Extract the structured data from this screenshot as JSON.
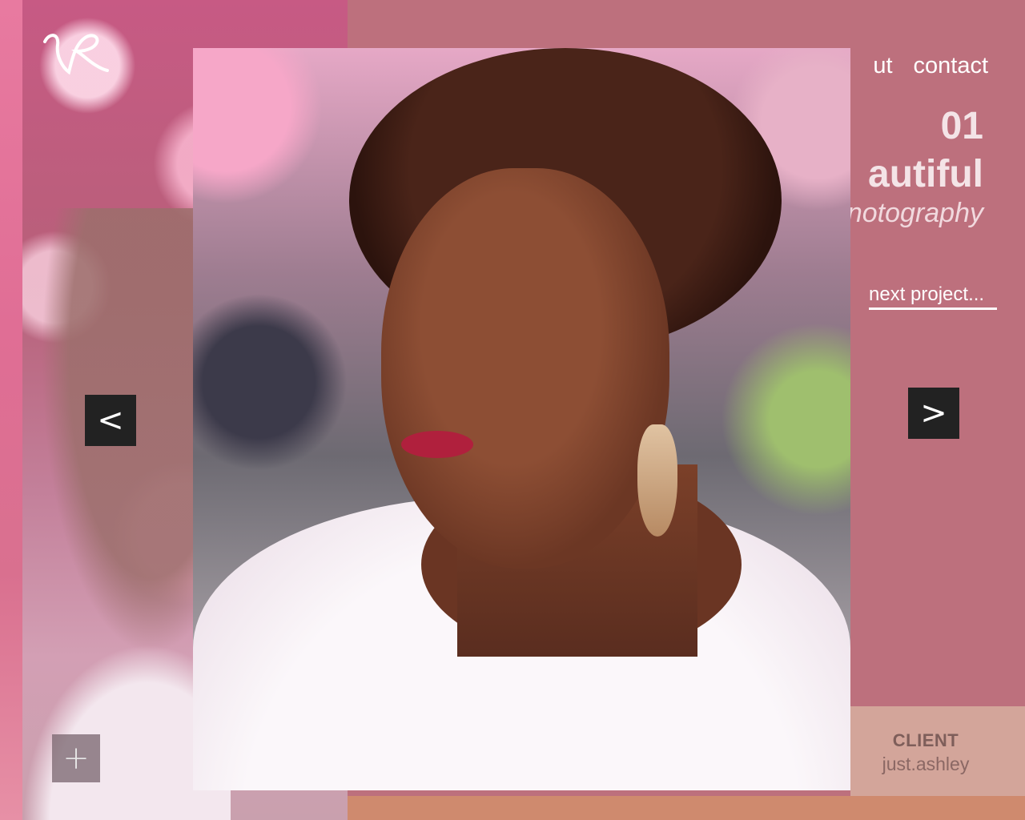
{
  "nav": {
    "about_label": "ut",
    "contact_label": "contact"
  },
  "project": {
    "number": "01",
    "title": "autiful",
    "subtitle": "notography",
    "next_label": "next project..."
  },
  "client": {
    "label": "CLIENT",
    "name": "just.ashley"
  },
  "controls": {
    "prev_symbol": "<",
    "next_symbol": ">",
    "plus_symbol": "+"
  },
  "colors": {
    "panel": "#bd707d",
    "client_box": "#d3a59a",
    "bottom_strip": "#cf8a6e",
    "button": "#222222"
  }
}
